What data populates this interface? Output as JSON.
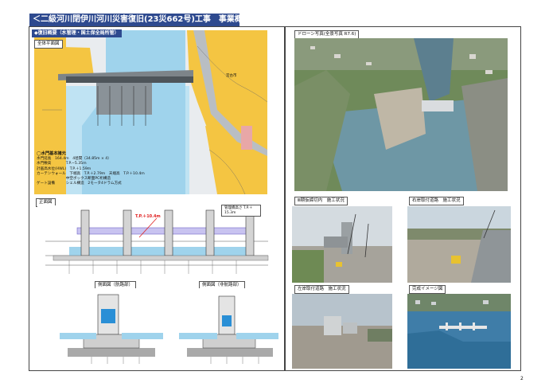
{
  "header": {
    "title": "＜二級河川閉伊川河川災害復旧(23災662号)工事　事業概要＞"
  },
  "left_panel": {
    "section_label": "◆復旧概要（水管理・国土保全局所管）",
    "plan_label": "全体平面図",
    "front_label": "正面図",
    "side_nav_label": "側面図（航路部）",
    "side_nonnav_label": "側面図（非航路部）",
    "spec": {
      "heading": "◯水門基本諸元",
      "rows": [
        "水門延長　164.4m　4径間（34.85m × 4）",
        "水門敷高　　　　T.P.−5.35m",
        "計画高水位(HWL)　T.P.＋1.59m",
        "カーテンウォール　下端高　T.P.＋2.79m　天端高　T.P.＋10.4m",
        "　　　　　　　　中空ボックス断面PC桁構造",
        "ゲート設備　　　シェル構造　2モータ4ドラム方式"
      ]
    },
    "map_text": "宮古市",
    "red_label": "T.P.＋10.4m",
    "box_label": "管理橋高さ T.P.＋15.3m"
  },
  "right_panel": {
    "drone_label": "ドローン写真(全景写真 R7.6)",
    "photo2_label": "Ⅲ期仮締切内　施工状況",
    "photo3_label": "右岸取付道路　施工状況",
    "photo4_label": "左岸取付道路　施工状況",
    "photo5_label": "完成イメージ図"
  },
  "footer": {
    "page_number": "2"
  },
  "colors": {
    "header_bg": "#2e4a8f",
    "map_yellow": "#f4c542",
    "water": "#9fd3ec",
    "red": "#e02020"
  }
}
